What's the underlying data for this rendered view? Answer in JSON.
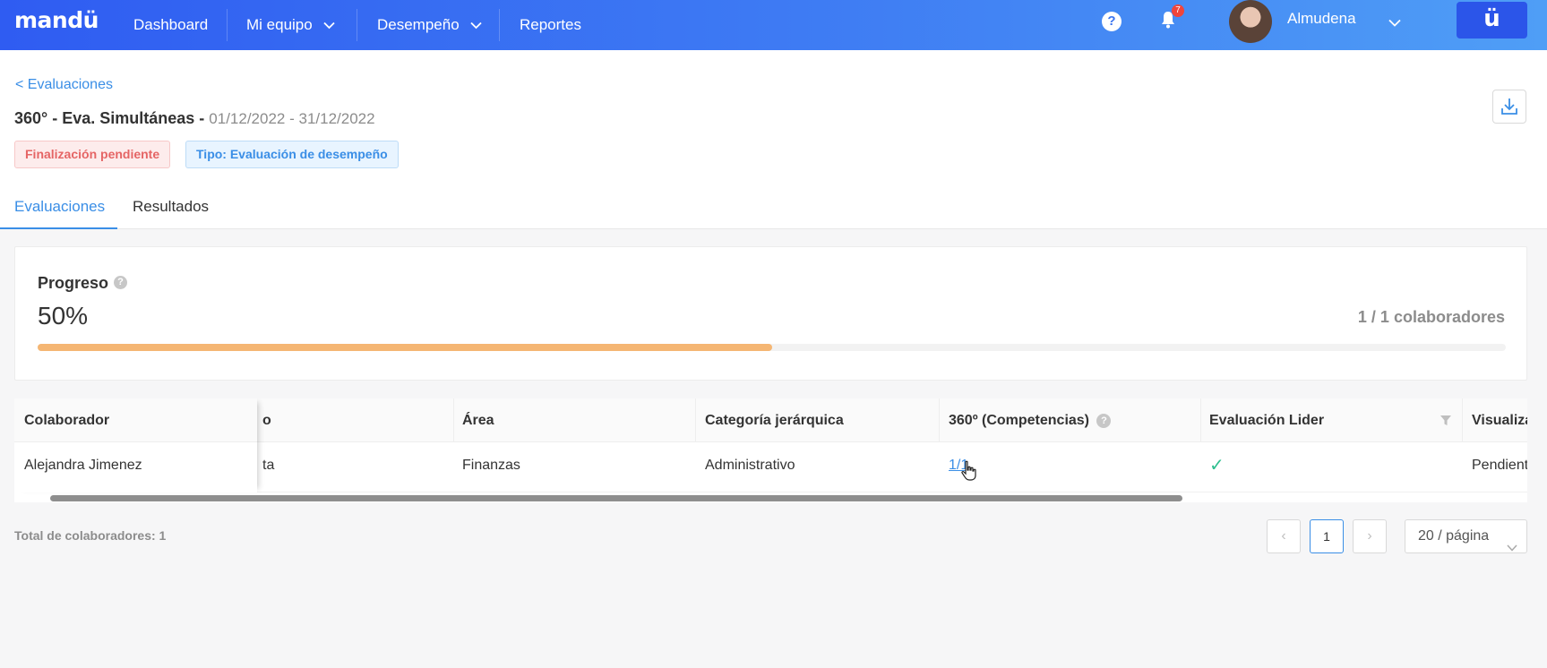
{
  "nav": {
    "logo": "mandü",
    "items": [
      "Dashboard",
      "Mi equipo",
      "Desempeño",
      "Reportes"
    ],
    "help_glyph": "?",
    "notification_count": "7",
    "user_name": "Almudena",
    "brand_button": "ü",
    "icons": [
      "help-icon",
      "bell-icon",
      "chevron-down-icon",
      "avatar"
    ]
  },
  "header": {
    "back_link": "< Evaluaciones",
    "title": "360° - Eva. Simultáneas - ",
    "dates": "01/12/2022 - 31/12/2022",
    "tags": [
      "Finalización pendiente",
      "Tipo: Evaluación de desempeño"
    ],
    "tabs": [
      "Evaluaciones",
      "Resultados"
    ],
    "active_tab": "Evaluaciones"
  },
  "progress": {
    "label": "Progreso",
    "info_glyph": "?",
    "percent_text": "50%",
    "fraction": 0.5,
    "count_text": "1 / 1 colaboradores",
    "fill_color": "#f5b673"
  },
  "table": {
    "columns": [
      "Colaborador",
      "o",
      "Área",
      "Categoría jerárquica",
      "360º (Competencias)",
      "Evaluación Lider",
      "Visualiza"
    ],
    "rows": [
      {
        "colaborador": "Alejandra Jimenez",
        "col2": "ta",
        "area": "Finanzas",
        "categoria": "Administrativo",
        "competencias": "1/1",
        "lider": "✓",
        "visualiza": "Pendient"
      }
    ]
  },
  "footer": {
    "total": "Total de colaboradores: 1",
    "prev": "‹",
    "page": "1",
    "next": "›",
    "page_size": "20 / página"
  },
  "colors": {
    "accent": "#3a8ee6",
    "nav_start": "#2f5cf2",
    "nav_end": "#4f9ef6",
    "check": "#2fbf8f"
  }
}
